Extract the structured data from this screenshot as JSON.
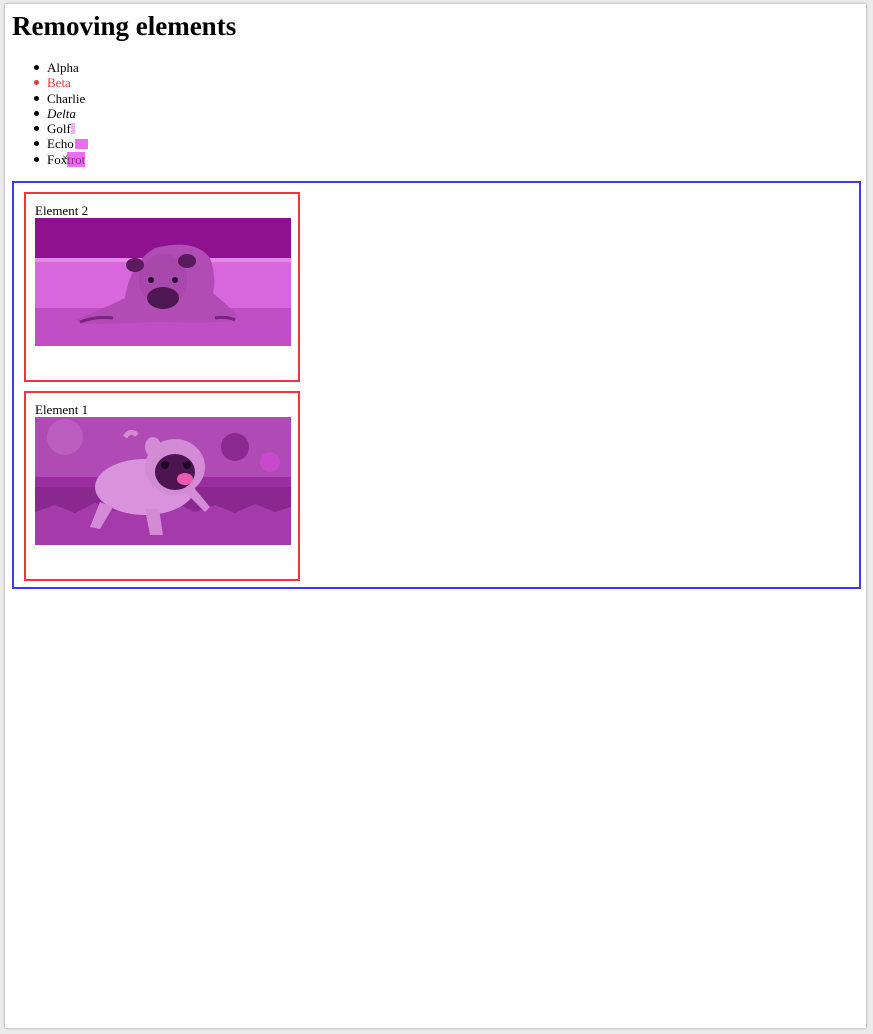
{
  "page": {
    "title": "Removing elements"
  },
  "list": {
    "items": [
      "Alpha",
      "Beta",
      "Charlie",
      "Delta",
      "Golf",
      "Echo",
      "Foxtrot"
    ],
    "foxtrot_prefix": "Fox",
    "foxtrot_highlight": "trot"
  },
  "cards": [
    {
      "label": "Element 2",
      "image": "pug-lying-down"
    },
    {
      "label": "Element 1",
      "image": "pug-running-grass"
    }
  ],
  "colors": {
    "highlight": "#eb6ef0",
    "beta_text": "#f0343c",
    "card_border": "#f0343c",
    "container_border": "#3a3af0",
    "image_tint": "#c03cc8"
  }
}
